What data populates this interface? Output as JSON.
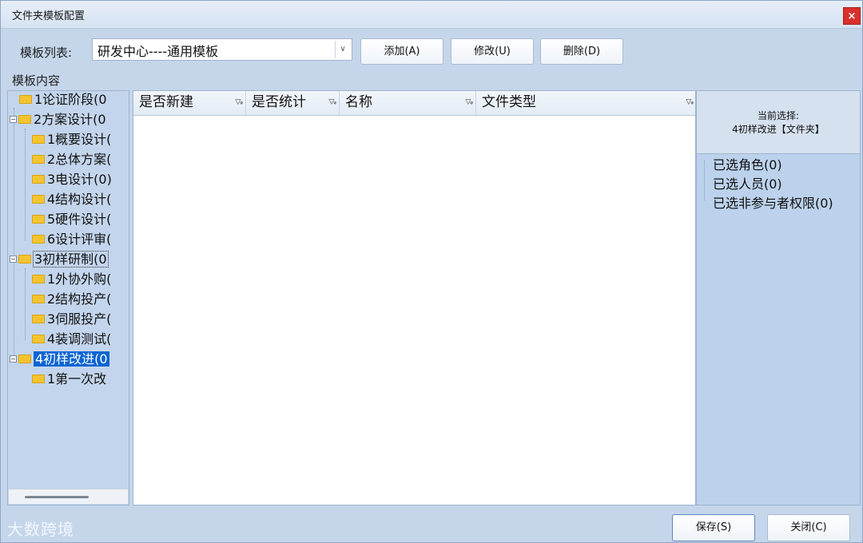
{
  "window": {
    "title": "文件夹模板配置",
    "close": "×"
  },
  "toolbar": {
    "template_list_label": "模板列表:",
    "template_selected": "研发中心----通用模板",
    "add_label": "添加(A)",
    "edit_label": "修改(U)",
    "delete_label": "删除(D)"
  },
  "content_label": "模板内容",
  "tree": {
    "items": [
      {
        "label": "1论证阶段(0"
      },
      {
        "label": "2方案设计(0"
      },
      {
        "label": "1概要设计("
      },
      {
        "label": "2总体方案("
      },
      {
        "label": "3电设计(0)"
      },
      {
        "label": "4结构设计("
      },
      {
        "label": "5硬件设计("
      },
      {
        "label": "6设计评审("
      },
      {
        "label": "3初样研制(0"
      },
      {
        "label": "1外协外购("
      },
      {
        "label": "2结构投产("
      },
      {
        "label": "3伺服投产("
      },
      {
        "label": "4装调测试("
      },
      {
        "label": "4初样改进(0"
      },
      {
        "label": "1第一次改"
      }
    ]
  },
  "grid": {
    "columns": [
      "是否新建",
      "是否统计",
      "名称",
      "文件类型"
    ],
    "rows": []
  },
  "selection": {
    "title": "当前选择:",
    "value": "4初样改进【文件夹】"
  },
  "rights": {
    "roles": "已选角色(0)",
    "users": "已选人员(0)",
    "non_participant": "已选非参与者权限(0)"
  },
  "footer": {
    "save_label": "保存(S)",
    "close_label": "关闭(C)"
  },
  "watermark": "大数跨境"
}
